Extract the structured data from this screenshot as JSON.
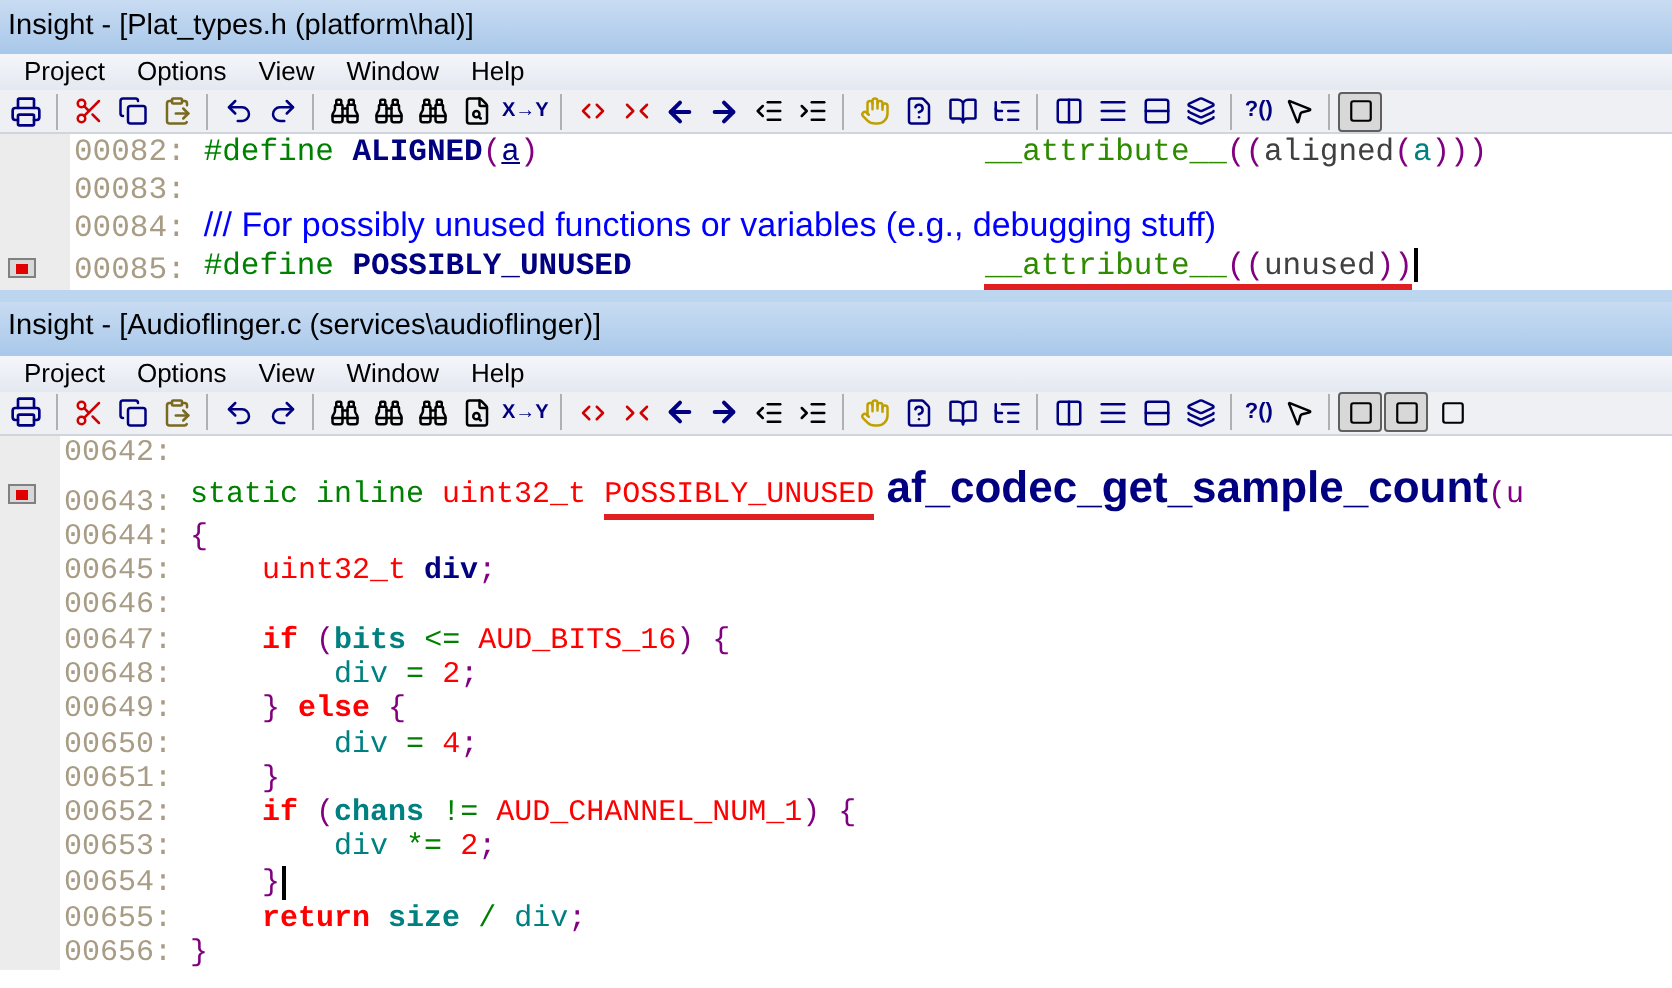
{
  "windows": [
    {
      "title": "Insight - [Plat_types.h (platform\\hal)]",
      "menu": [
        "Project",
        "Options",
        "View",
        "Window",
        "Help"
      ],
      "toolbar": {
        "labels": [
          "X→Y",
          "?()"
        ],
        "mode_buttons": [
          {
            "pressed": true
          }
        ]
      },
      "lines": [
        {
          "number": "00082:",
          "bookmark": false,
          "cursor": false,
          "tokens": [
            {
              "text": "#define ",
              "kind": "pre"
            },
            {
              "text": "ALIGNED",
              "kind": "macro"
            },
            {
              "text": "(",
              "kind": "punct"
            },
            {
              "text": "a",
              "kind": "param"
            },
            {
              "text": ")",
              "kind": "punct"
            }
          ],
          "trailing": [
            {
              "text": "__attribute__",
              "kind": "attr"
            },
            {
              "text": "((",
              "kind": "punct"
            },
            {
              "text": "aligned",
              "kind": "plain"
            },
            {
              "text": "(",
              "kind": "punct"
            },
            {
              "text": "a",
              "kind": "ident"
            },
            {
              "text": ")))",
              "kind": "punct"
            }
          ]
        },
        {
          "number": "00083:",
          "bookmark": false,
          "cursor": false
        },
        {
          "number": "00084:",
          "bookmark": false,
          "cursor": false,
          "tokens": [
            {
              "text": "/// For possibly unused functions or variables (e.g., debugging stuff)",
              "kind": "comment"
            }
          ]
        },
        {
          "number": "00085:",
          "bookmark": true,
          "cursor": true,
          "tokens": [
            {
              "text": "#define ",
              "kind": "pre"
            },
            {
              "text": "POSSIBLY_UNUSED",
              "kind": "macro"
            }
          ],
          "trailing": [
            {
              "text": "__attribute__",
              "kind": "attr",
              "underlined": true
            },
            {
              "text": "((",
              "kind": "punct",
              "underlined": true
            },
            {
              "text": "unused",
              "kind": "plain",
              "underlined": true
            },
            {
              "text": "))",
              "kind": "punct",
              "underlined": true
            }
          ]
        }
      ]
    },
    {
      "title": "Insight - [Audioflinger.c (services\\audioflinger)]",
      "menu": [
        "Project",
        "Options",
        "View",
        "Window",
        "Help"
      ],
      "toolbar": {
        "labels": [
          "X→Y",
          "?()"
        ],
        "mode_buttons": [
          {
            "pressed": true
          },
          {
            "pressed": true
          },
          {
            "pressed": false
          }
        ]
      },
      "lines": [
        {
          "number": "00642:",
          "bookmark": false,
          "cursor": false
        },
        {
          "number": "00643:",
          "bookmark": true,
          "cursor": false,
          "tokens": [
            {
              "text": "static inline ",
              "kind": "pre"
            },
            {
              "text": "uint32_t ",
              "kind": "type"
            },
            {
              "text": "POSSIBLY_UNUSED",
              "kind": "type",
              "underlined": true
            },
            {
              "text": " af_codec_get_sample_count",
              "kind": "fn"
            },
            {
              "text": "(u",
              "kind": "punct"
            }
          ]
        },
        {
          "number": "00644:",
          "bookmark": false,
          "cursor": false,
          "tokens": [
            {
              "text": "{",
              "kind": "punct"
            }
          ]
        },
        {
          "number": "00645:",
          "bookmark": false,
          "cursor": false,
          "tokens": [
            {
              "text": "    uint32_t ",
              "kind": "type"
            },
            {
              "text": "div",
              "kind": "macro"
            },
            {
              "text": ";",
              "kind": "punct"
            }
          ]
        },
        {
          "number": "00646:",
          "bookmark": false,
          "cursor": false
        },
        {
          "number": "00647:",
          "bookmark": false,
          "cursor": false,
          "tokens": [
            {
              "text": "    if ",
              "kind": "kw"
            },
            {
              "text": "(",
              "kind": "punct"
            },
            {
              "text": "bits",
              "kind": "local"
            },
            {
              "text": " <= ",
              "kind": "op"
            },
            {
              "text": "AUD_BITS_16",
              "kind": "type"
            },
            {
              "text": ") {",
              "kind": "punct"
            }
          ]
        },
        {
          "number": "00648:",
          "bookmark": false,
          "cursor": false,
          "tokens": [
            {
              "text": "        div",
              "kind": "ident"
            },
            {
              "text": " = ",
              "kind": "op"
            },
            {
              "text": "2",
              "kind": "type"
            },
            {
              "text": ";",
              "kind": "punct"
            }
          ]
        },
        {
          "number": "00649:",
          "bookmark": false,
          "cursor": false,
          "tokens": [
            {
              "text": "    } ",
              "kind": "punct"
            },
            {
              "text": "else ",
              "kind": "kw"
            },
            {
              "text": "{",
              "kind": "punct"
            }
          ]
        },
        {
          "number": "00650:",
          "bookmark": false,
          "cursor": false,
          "tokens": [
            {
              "text": "        div",
              "kind": "ident"
            },
            {
              "text": " = ",
              "kind": "op"
            },
            {
              "text": "4",
              "kind": "type"
            },
            {
              "text": ";",
              "kind": "punct"
            }
          ]
        },
        {
          "number": "00651:",
          "bookmark": false,
          "cursor": false,
          "tokens": [
            {
              "text": "    }",
              "kind": "punct"
            }
          ]
        },
        {
          "number": "00652:",
          "bookmark": false,
          "cursor": false,
          "tokens": [
            {
              "text": "    if ",
              "kind": "kw"
            },
            {
              "text": "(",
              "kind": "punct"
            },
            {
              "text": "chans",
              "kind": "local"
            },
            {
              "text": " != ",
              "kind": "op"
            },
            {
              "text": "AUD_CHANNEL_NUM_1",
              "kind": "type"
            },
            {
              "text": ") {",
              "kind": "punct"
            }
          ]
        },
        {
          "number": "00653:",
          "bookmark": false,
          "cursor": false,
          "tokens": [
            {
              "text": "        div",
              "kind": "ident"
            },
            {
              "text": " *= ",
              "kind": "op"
            },
            {
              "text": "2",
              "kind": "type"
            },
            {
              "text": ";",
              "kind": "punct"
            }
          ]
        },
        {
          "number": "00654:",
          "bookmark": false,
          "cursor": true,
          "tokens": [
            {
              "text": "    }",
              "kind": "punct"
            }
          ]
        },
        {
          "number": "00655:",
          "bookmark": false,
          "cursor": false,
          "tokens": [
            {
              "text": "    return ",
              "kind": "kw"
            },
            {
              "text": "size",
              "kind": "local"
            },
            {
              "text": " / ",
              "kind": "op"
            },
            {
              "text": "div",
              "kind": "ident"
            },
            {
              "text": ";",
              "kind": "punct"
            }
          ]
        },
        {
          "number": "00656:",
          "bookmark": false,
          "cursor": false,
          "tokens": [
            {
              "text": "}",
              "kind": "punct"
            }
          ]
        }
      ]
    }
  ]
}
